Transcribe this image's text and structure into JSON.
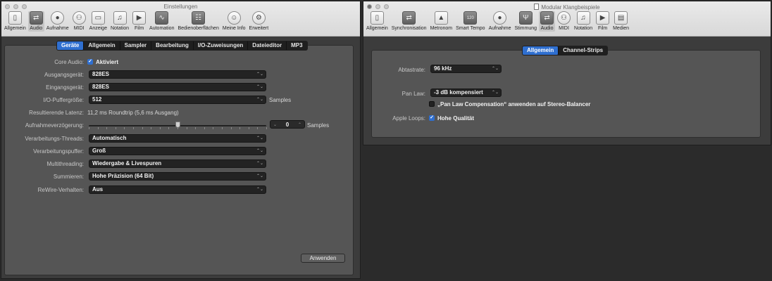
{
  "prefs": {
    "title": "Einstellungen",
    "toolbar": [
      {
        "label": "Allgemein",
        "icon": "▯",
        "icon_name": "switch-icon"
      },
      {
        "label": "Audio",
        "icon": "⇄",
        "icon_name": "audio-icon"
      },
      {
        "label": "Aufnahme",
        "icon": "●",
        "icon_name": "record-icon"
      },
      {
        "label": "MIDI",
        "icon": "⚇",
        "icon_name": "midi-icon"
      },
      {
        "label": "Anzeige",
        "icon": "▭",
        "icon_name": "display-icon"
      },
      {
        "label": "Notation",
        "icon": "♫",
        "icon_name": "notation-icon"
      },
      {
        "label": "Film",
        "icon": "▶",
        "icon_name": "film-icon"
      },
      {
        "label": "Automation",
        "icon": "∿",
        "icon_name": "automation-icon"
      },
      {
        "label": "Bedienoberflächen",
        "icon": "☷",
        "icon_name": "control-surfaces-icon"
      },
      {
        "label": "Meine Info",
        "icon": "☺",
        "icon_name": "my-info-icon"
      },
      {
        "label": "Erweitert",
        "icon": "⚙",
        "icon_name": "advanced-gear-icon"
      }
    ],
    "tabs": [
      "Geräte",
      "Allgemein",
      "Sampler",
      "Bearbeitung",
      "I/O-Zuweisungen",
      "Dateieditor",
      "MP3"
    ],
    "core_audio": {
      "label": "Core Audio:",
      "value": "Aktiviert"
    },
    "output_device": {
      "label": "Ausgangsgerät:",
      "value": "828ES"
    },
    "input_device": {
      "label": "Eingangsgerät:",
      "value": "828ES"
    },
    "buffer": {
      "label": "I/O-Puffergröße:",
      "value": "512",
      "unit": "Samples"
    },
    "latency": {
      "label": "Resultierende Latenz:",
      "value": "11,2 ms Roundtrip (5,6 ms Ausgang)"
    },
    "rec_delay": {
      "label": "Aufnahmeverzögerung:",
      "value": "0",
      "unit": "Samples",
      "slider_fraction": 0.5
    },
    "threads": {
      "label": "Verarbeitungs-Threads:",
      "value": "Automatisch"
    },
    "proc_buffer": {
      "label": "Verarbeitungspuffer:",
      "value": "Groß"
    },
    "multithreading": {
      "label": "Multithreading:",
      "value": "Wiedergabe & Livespuren"
    },
    "summing": {
      "label": "Summieren:",
      "value": "Hohe Präzision (64 Bit)"
    },
    "rewire": {
      "label": "ReWire-Verhalten:",
      "value": "Aus"
    },
    "apply_button": "Anwenden"
  },
  "project": {
    "title": "Modular Klangbeispiele",
    "toolbar": [
      {
        "label": "Allgemein",
        "icon": "▯",
        "icon_name": "switch-icon"
      },
      {
        "label": "Synchronisation",
        "icon": "⇄",
        "icon_name": "sync-icon"
      },
      {
        "label": "Metronom",
        "icon": "▲",
        "icon_name": "metronome-icon"
      },
      {
        "label": "Smart Tempo",
        "icon": "120",
        "icon_name": "smart-tempo-icon"
      },
      {
        "label": "Aufnahme",
        "icon": "●",
        "icon_name": "record-icon"
      },
      {
        "label": "Stimmung",
        "icon": "Ψ",
        "icon_name": "tuning-fork-icon"
      },
      {
        "label": "Audio",
        "icon": "⇄",
        "icon_name": "audio-icon"
      },
      {
        "label": "MIDI",
        "icon": "⚇",
        "icon_name": "midi-icon"
      },
      {
        "label": "Notation",
        "icon": "♫",
        "icon_name": "notation-icon"
      },
      {
        "label": "Film",
        "icon": "▶",
        "icon_name": "film-icon"
      },
      {
        "label": "Medien",
        "icon": "▤",
        "icon_name": "media-briefcase-icon"
      }
    ],
    "tabs": [
      "Allgemein",
      "Channel-Strips"
    ],
    "sample_rate": {
      "label": "Abtastrate:",
      "value": "96 kHz"
    },
    "pan_law": {
      "label": "Pan Law:",
      "value": "-3 dB kompensiert"
    },
    "pan_comp": "„Pan Law Compensation“ anwenden auf Stereo-Balancer",
    "apple_loops": {
      "label": "Apple Loops:",
      "value": "Hohe Qualität"
    }
  },
  "colors": {
    "accent": "#2f6fd0",
    "panel": "#555555",
    "window": "#3c3c3c"
  }
}
